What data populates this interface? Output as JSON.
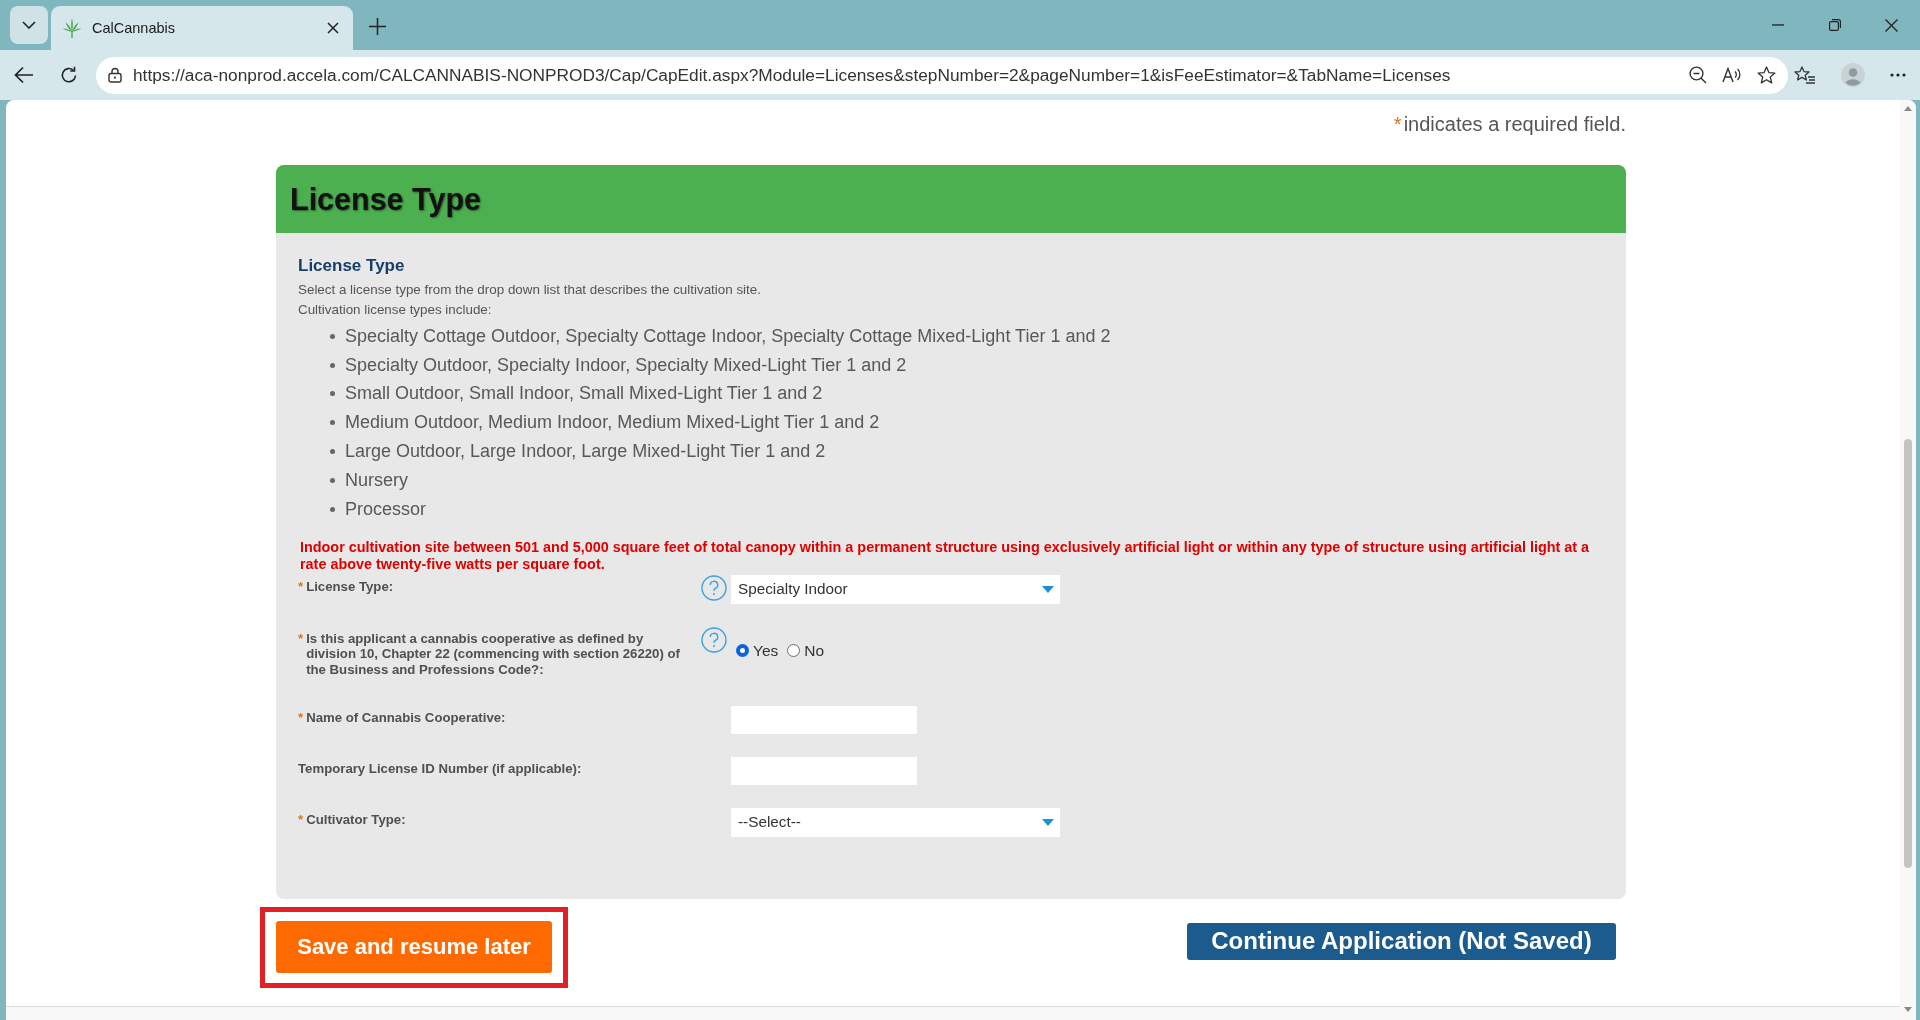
{
  "browser": {
    "tabs": [
      {
        "title": "CalCannabis",
        "selected": true
      }
    ],
    "url": "https://aca-nonprod.accela.com/CALCANNABIS-NONPROD3/Cap/CapEdit.aspx?Module=Licenses&stepNumber=2&pageNumber=1&isFeeEstimator=&TabName=Licenses"
  },
  "required_note": {
    "mark": "*",
    "text": "indicates a required field."
  },
  "section": {
    "title": "License Type",
    "subtitle": "License Type",
    "description": [
      "Select a license type from the drop down list that describes the cultivation site.",
      "Cultivation license types include:"
    ],
    "license_types": [
      "Specialty Cottage Outdoor, Specialty Cottage Indoor, Specialty Cottage Mixed-Light Tier 1 and 2",
      "Specialty Outdoor, Specialty Indoor, Specialty Mixed-Light Tier 1 and 2",
      "Small Outdoor, Small Indoor, Small Mixed-Light Tier 1 and 2",
      "Medium Outdoor, Medium Indoor, Medium Mixed-Light Tier 1 and 2",
      "Large Outdoor, Large Indoor, Large Mixed-Light Tier 1 and 2",
      "Nursery",
      "Processor"
    ],
    "notice": "Indoor cultivation site between 501 and 5,000 square feet of total canopy within a permanent structure using exclusively artificial light or within any type of structure using artificial light at a rate above twenty-five watts per square foot.",
    "fields": [
      {
        "kind": "select",
        "mark": "*",
        "label": "License Type:",
        "help": true,
        "value": "Specialty Indoor"
      },
      {
        "kind": "radio",
        "mark": "*",
        "label": "Is this applicant a cannabis cooperative as defined by division 10, Chapter 22 (commencing with section 26220) of the Business and Professions Code?:",
        "help": true,
        "options": [
          {
            "label": "Yes",
            "selected": true
          },
          {
            "label": "No",
            "selected": false
          }
        ]
      },
      {
        "kind": "text",
        "mark": "*",
        "label": "Name of Cannabis Cooperative:",
        "help": false
      },
      {
        "kind": "text",
        "label": "Temporary License ID Number (if applicable):",
        "help": false
      },
      {
        "kind": "select",
        "mark": "*",
        "label": "Cultivator Type:",
        "help": false,
        "value": "--Select--"
      }
    ]
  },
  "buttons": [
    {
      "kind": "save",
      "label": "Save and resume later",
      "highlighted": true
    },
    {
      "kind": "continue",
      "label": "Continue Application (Not Saved)",
      "highlighted": false
    }
  ]
}
